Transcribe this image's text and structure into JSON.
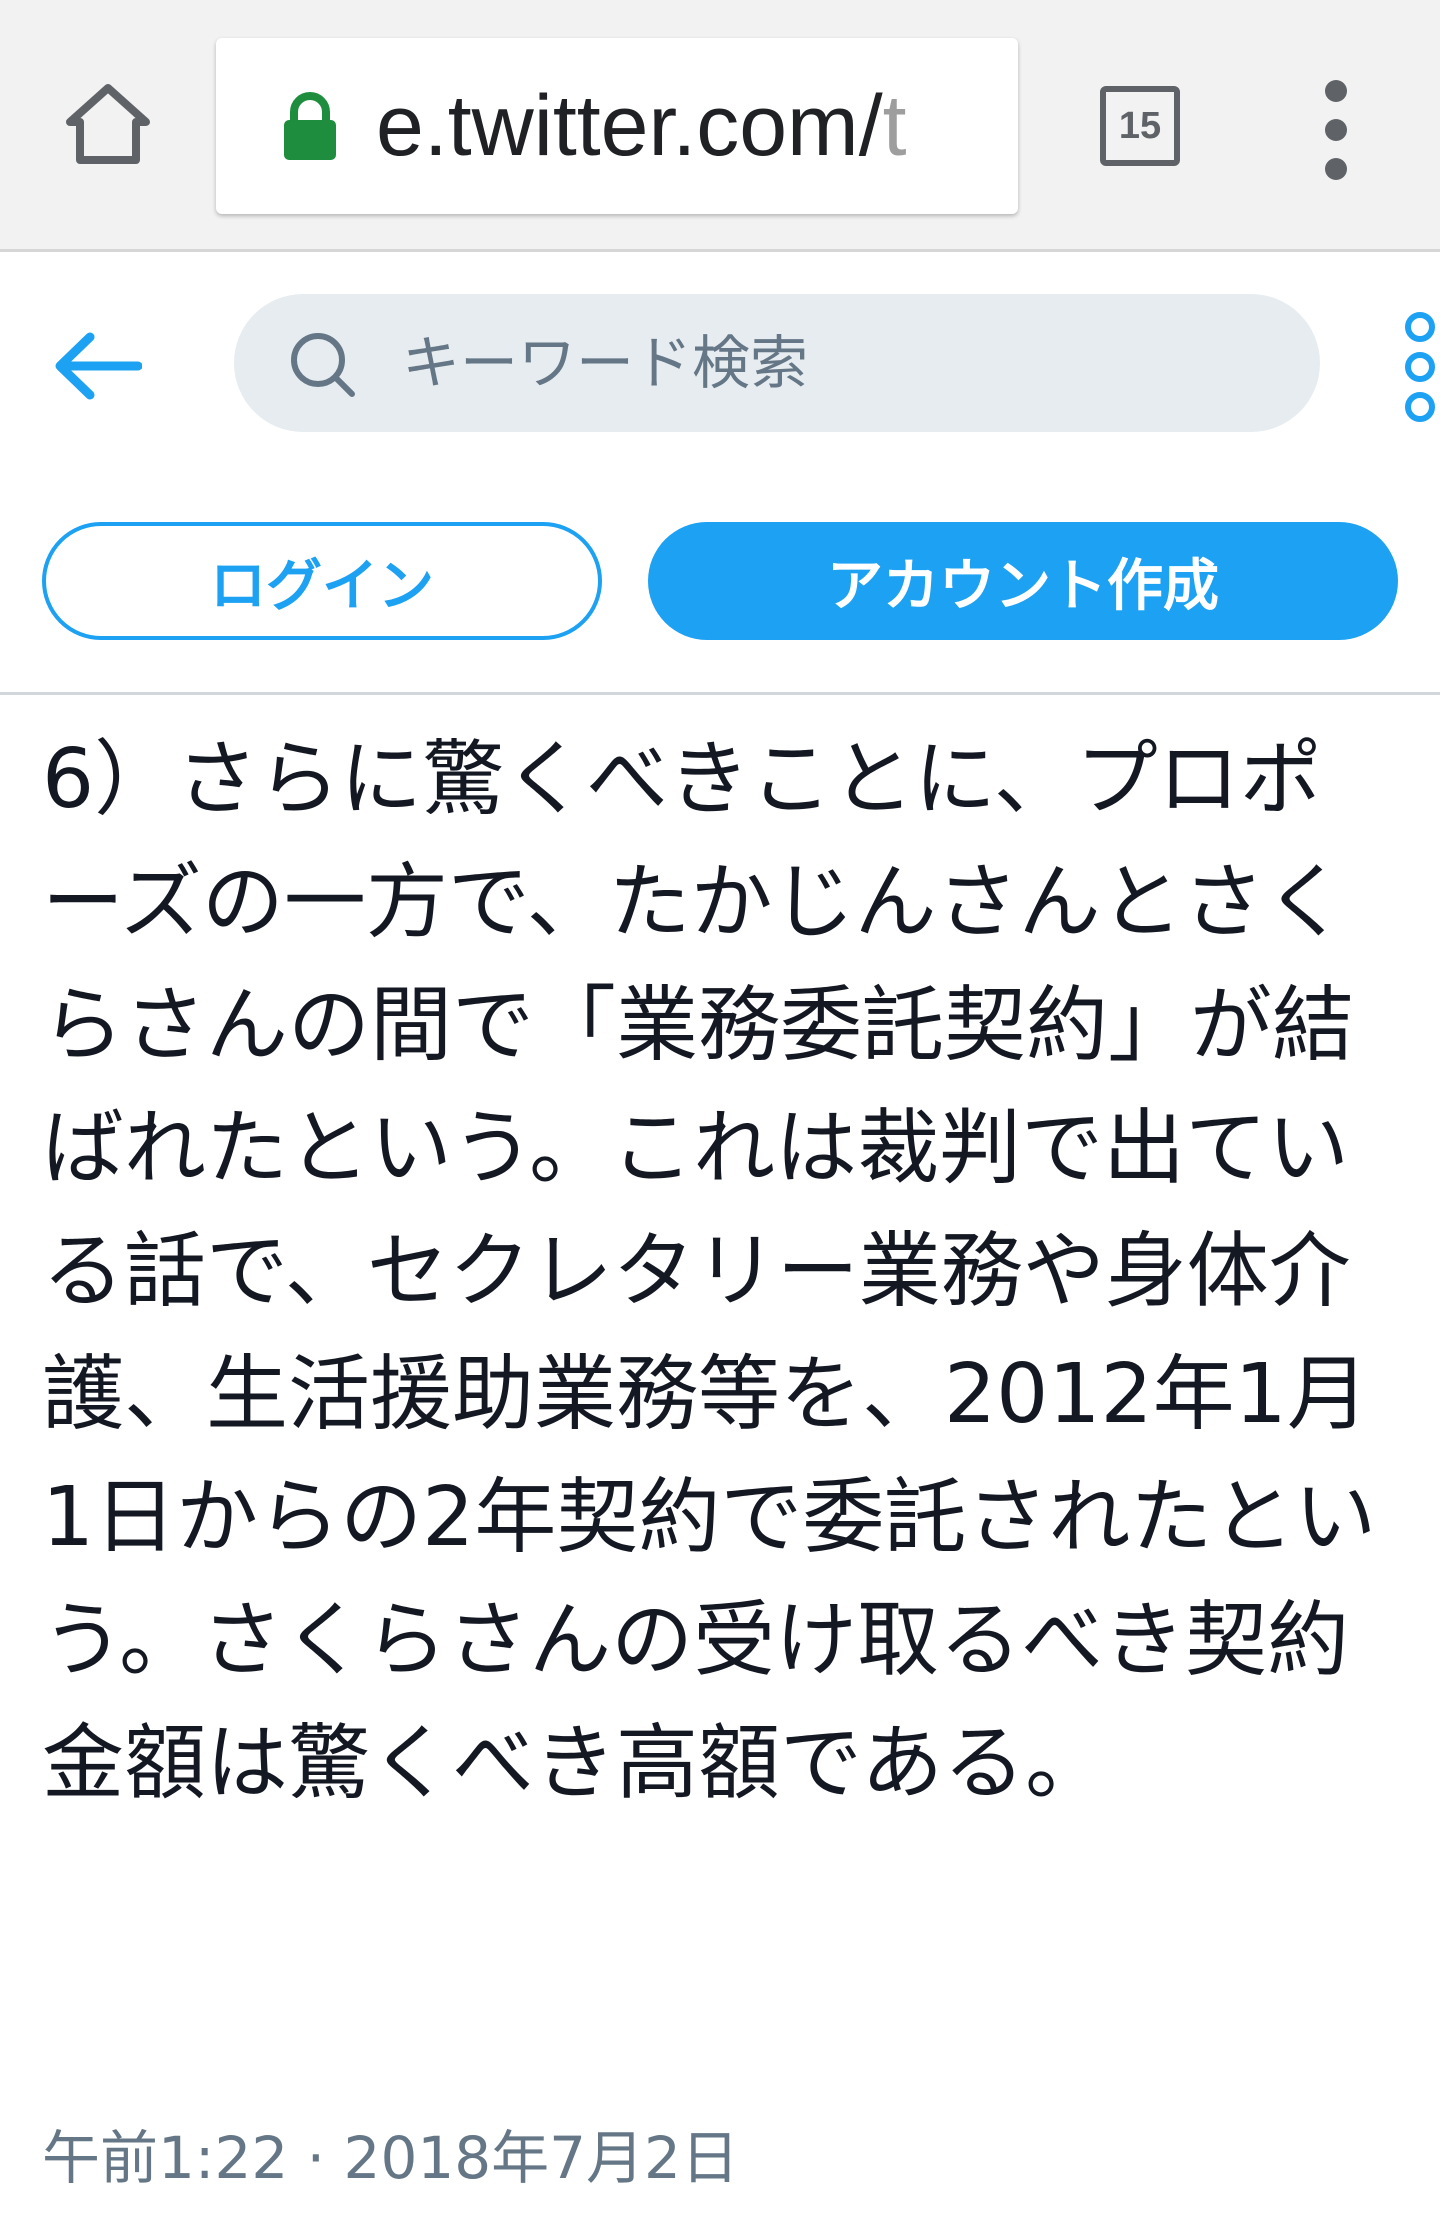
{
  "browser": {
    "url_main": "e.twitter.com/",
    "url_tail": "t",
    "tab_count": "15",
    "icons": {
      "home": "home-icon",
      "lock": "lock-icon",
      "tabs": "tab-switcher-icon",
      "menu": "more-vert-icon"
    },
    "colors": {
      "lock": "#1e8e3e",
      "chrome_bg": "#f2f2f2"
    }
  },
  "header": {
    "search_placeholder": "キーワード検索",
    "icons": {
      "back": "arrow-left-icon",
      "search": "search-icon",
      "more": "more-vert-icon"
    }
  },
  "auth": {
    "login_label": "ログイン",
    "signup_label": "アカウント作成"
  },
  "tweet": {
    "text": "6）さらに驚くべきことに、プロポーズの一方で、たかじんさんとさくらさんの間で「業務委託契約」が結ばれたという。これは裁判で出ている話で、セクレタリー業務や身体介護、生活援助業務等を、2012年1月1日からの2年契約で委託されたという。さくらさんの受け取るべき契約金額は驚くべき高額である。",
    "timestamp": "午前1:22 · 2018年7月2日"
  },
  "colors": {
    "accent": "#1da1f2",
    "text": "#141823",
    "muted": "#657786",
    "search_bg": "#e6ecf0"
  }
}
